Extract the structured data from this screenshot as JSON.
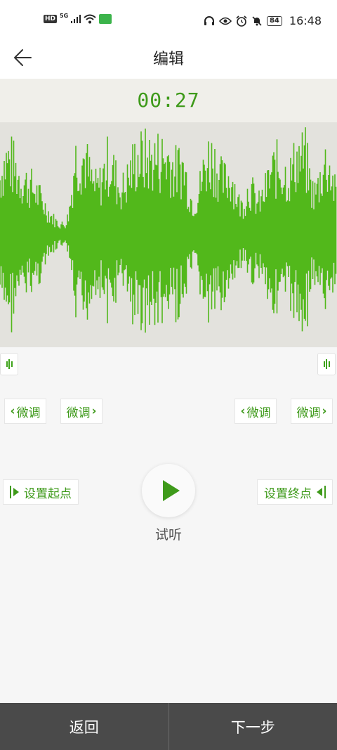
{
  "status": {
    "hd": "HD",
    "net": "5G",
    "battery": "84",
    "time": "16:48"
  },
  "header": {
    "title": "编辑",
    "back_icon": "arrow-left-icon"
  },
  "timer": "00:27",
  "colors": {
    "accent": "#3e9a1a",
    "wave": "#52b81b",
    "wave_bg": "#e3e2dd",
    "bottom_bar": "#4a4a4a"
  },
  "controls": {
    "left_fine_back": "微调",
    "left_fine_fwd": "微调",
    "right_fine_back": "微调",
    "right_fine_fwd": "微调",
    "set_start": "设置起点",
    "set_end": "设置终点",
    "listen": "试听"
  },
  "bottom": {
    "back": "返回",
    "next": "下一步"
  }
}
